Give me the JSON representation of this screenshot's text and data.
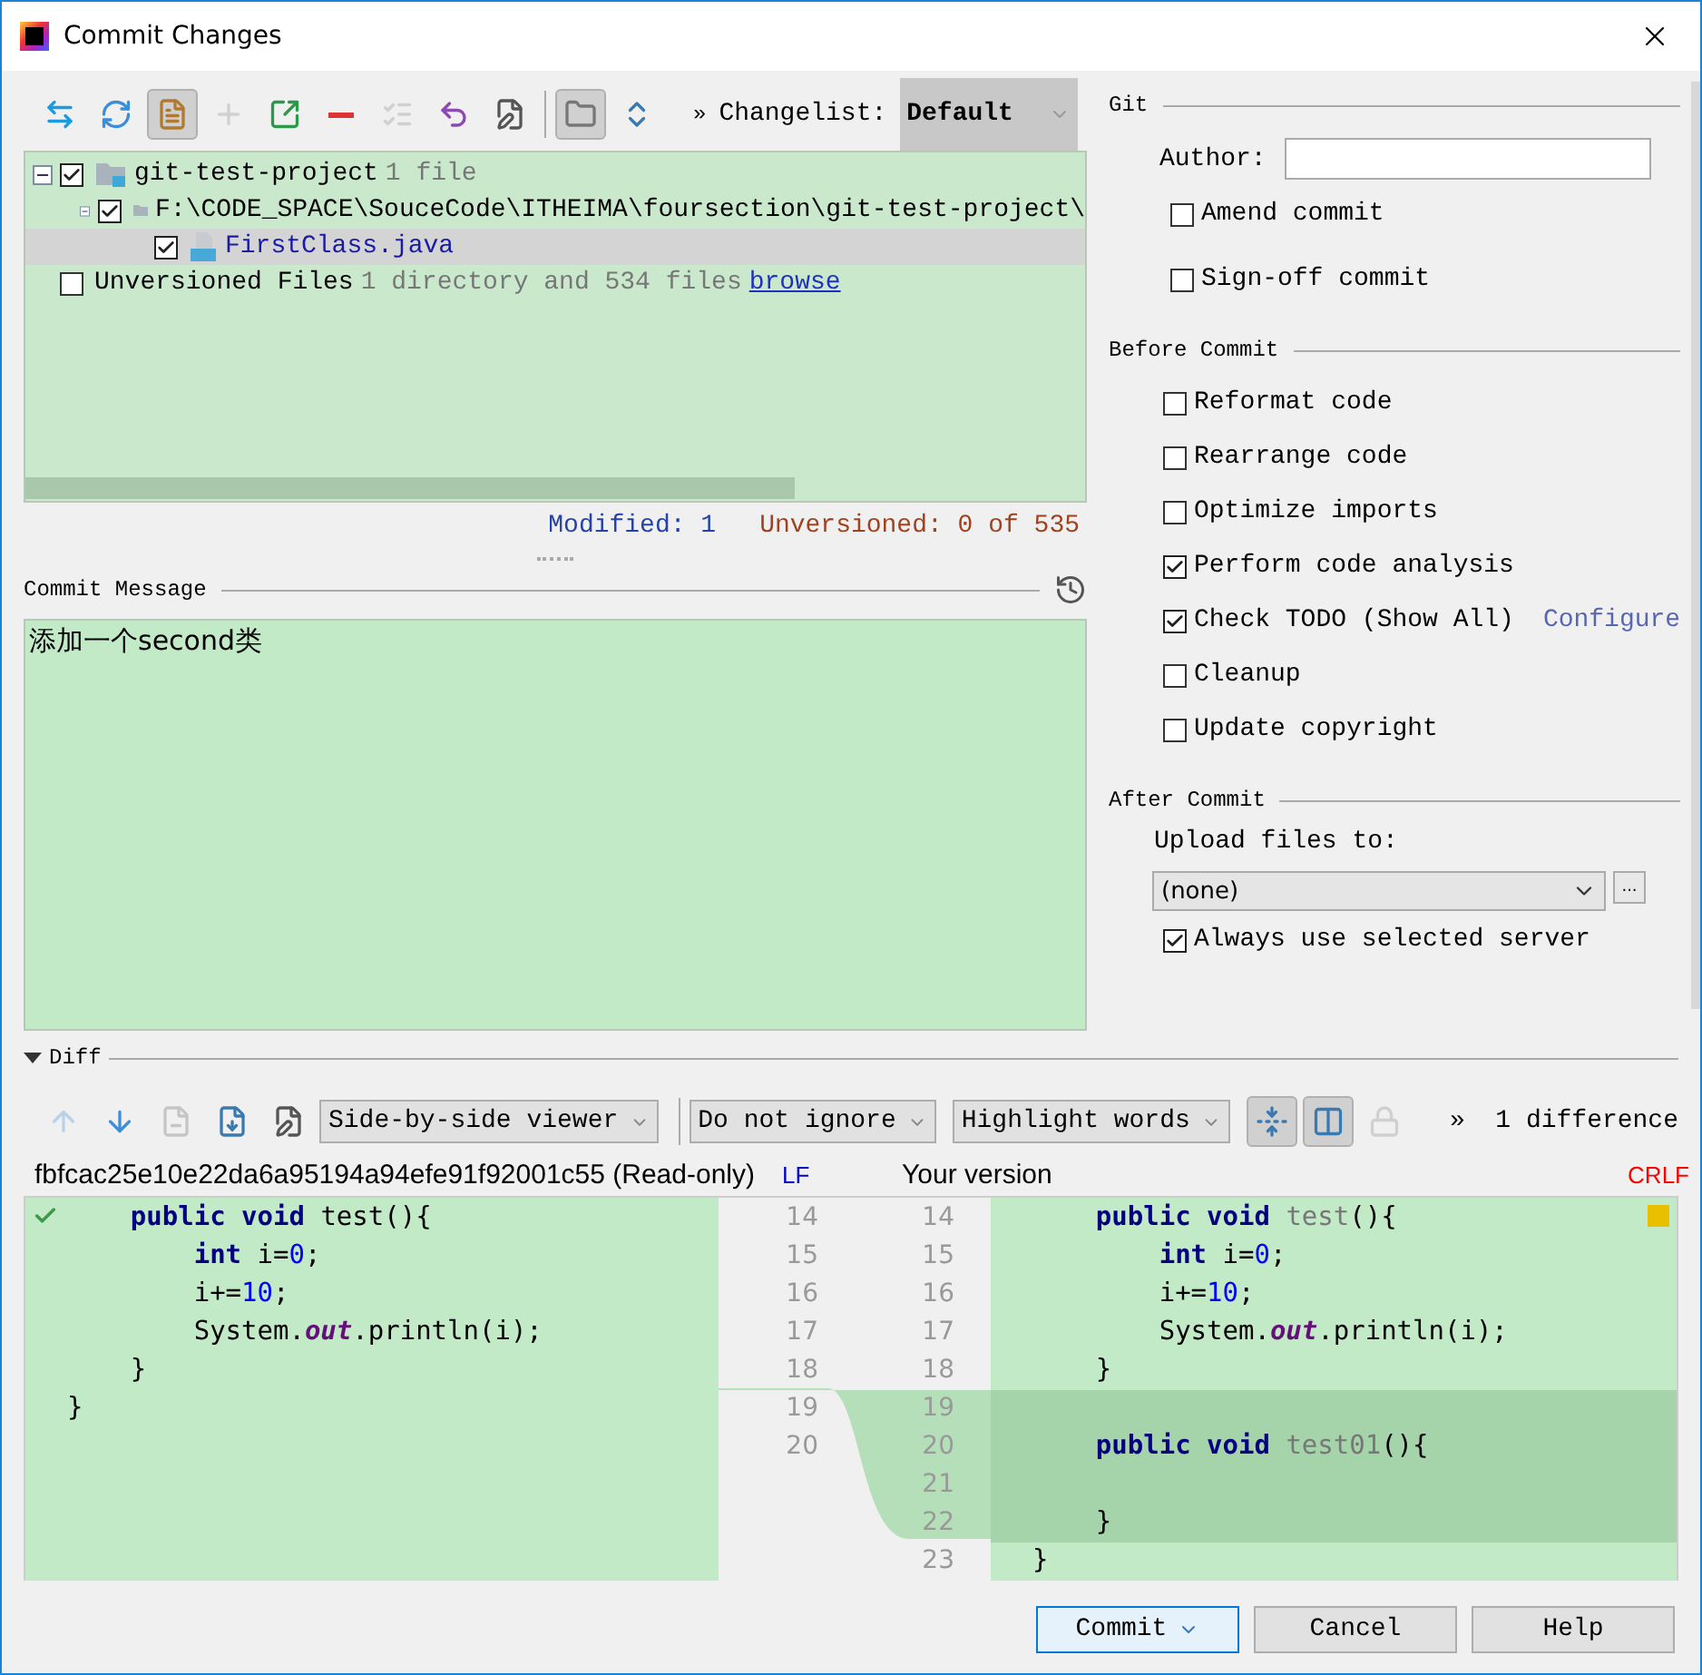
{
  "window": {
    "title": "Commit Changes"
  },
  "changes_toolbar": [
    {
      "kind": "move",
      "pressed": false,
      "disabled": false
    },
    {
      "kind": "refresh",
      "pressed": false,
      "disabled": false
    },
    {
      "kind": "document",
      "pressed": true,
      "disabled": false
    },
    {
      "kind": "add",
      "pressed": false,
      "disabled": true
    },
    {
      "kind": "move-to",
      "pressed": false,
      "disabled": false
    },
    {
      "kind": "remove",
      "pressed": false,
      "disabled": false
    },
    {
      "kind": "group",
      "pressed": false,
      "disabled": true
    },
    {
      "kind": "rollback",
      "pressed": false,
      "disabled": false
    },
    {
      "kind": "edit",
      "pressed": false,
      "disabled": false
    },
    {
      "kind": "separator"
    },
    {
      "kind": "folders",
      "pressed": true,
      "disabled": false
    },
    {
      "kind": "expand",
      "pressed": false,
      "disabled": false
    }
  ],
  "changelist": {
    "overflow": "»",
    "label": "Changelist:",
    "value": "Default"
  },
  "tree": [
    {
      "kind": "module",
      "label": "git-test-project",
      "meta": "1 file",
      "checked": true,
      "expanded": true,
      "selected": false,
      "children": [
        {
          "kind": "folder",
          "label": "F:\\CODE_SPACE\\SouceCode\\ITHEIMA\\foursection\\git-test-project\\",
          "checked": true,
          "expanded": true,
          "selected": false,
          "children": [
            {
              "kind": "file",
              "label": "FirstClass.java",
              "checked": true,
              "selected": true
            }
          ]
        }
      ]
    },
    {
      "kind": "group",
      "label": "Unversioned Files",
      "meta": "1 directory and 534 files",
      "link": "browse",
      "checked": false,
      "selected": false
    }
  ],
  "status": {
    "modified": "Modified: 1",
    "unversioned": "Unversioned: 0 of 535"
  },
  "commit_message": {
    "label": "Commit Message",
    "value": "添加一个second类"
  },
  "git": {
    "title": "Git",
    "author_label": "Author:",
    "options": [
      {
        "label": "Amend commit",
        "checked": false
      },
      {
        "label": "Sign-off commit",
        "checked": false
      }
    ]
  },
  "before_commit": {
    "title": "Before Commit",
    "options": [
      {
        "label": "Reformat code",
        "checked": false
      },
      {
        "label": "Rearrange code",
        "checked": false
      },
      {
        "label": "Optimize imports",
        "checked": false
      },
      {
        "label": "Perform code analysis",
        "checked": true
      },
      {
        "label": "Check TODO (Show All)",
        "checked": true,
        "link": "Configure"
      },
      {
        "label": "Cleanup",
        "checked": false
      },
      {
        "label": "Update copyright",
        "checked": false
      }
    ]
  },
  "after_commit": {
    "title": "After Commit",
    "upload_label": "Upload files to:",
    "upload_value": "(none)",
    "more": "...",
    "options": [
      {
        "label": "Always use selected server",
        "checked": true
      }
    ]
  },
  "diff": {
    "title": "Diff",
    "expanded": true,
    "toolbar": [
      {
        "kind": "previous",
        "disabled": true
      },
      {
        "kind": "next",
        "disabled": false
      },
      {
        "kind": "close-file",
        "disabled": true
      },
      {
        "kind": "open-file",
        "disabled": false
      },
      {
        "kind": "edit",
        "disabled": false
      }
    ],
    "dropdowns": [
      "Side-by-side viewer",
      "Do not ignore",
      "Highlight words"
    ],
    "toggles": [
      {
        "kind": "collapse",
        "pressed": true,
        "disabled": false
      },
      {
        "kind": "columns",
        "pressed": true,
        "disabled": false
      },
      {
        "kind": "lock",
        "pressed": false,
        "disabled": true
      }
    ],
    "overflow": "»",
    "differences": "1 difference",
    "left": {
      "title": "fbfcac25e10e22da6a95194a94efe91f92001c55 (Read-only)",
      "line_separator": "LF",
      "lines": [
        {
          "number": "14",
          "changed": false,
          "segments": [
            {
              "text": "    public",
              "kind": "keyword"
            },
            {
              "text": " void",
              "kind": "keyword"
            },
            {
              "text": " test(){"
            }
          ]
        },
        {
          "number": "15",
          "changed": false,
          "segments": [
            {
              "text": "        int",
              "kind": "keyword"
            },
            {
              "text": " i="
            },
            {
              "text": "0",
              "kind": "number"
            },
            {
              "text": ";"
            }
          ]
        },
        {
          "number": "16",
          "changed": false,
          "segments": [
            {
              "text": "        i+="
            },
            {
              "text": "10",
              "kind": "number"
            },
            {
              "text": ";"
            }
          ]
        },
        {
          "number": "17",
          "changed": false,
          "segments": [
            {
              "text": "        System."
            },
            {
              "text": "out",
              "kind": "field"
            },
            {
              "text": ".println(i);"
            }
          ]
        },
        {
          "number": "18",
          "changed": false,
          "segments": [
            {
              "text": "    }"
            }
          ]
        },
        {
          "number": "19",
          "changed": false,
          "segments": [
            {
              "text": "}"
            }
          ]
        },
        {
          "number": "20",
          "changed": false
        }
      ]
    },
    "right": {
      "title": "Your version",
      "line_separator": "CRLF",
      "lines": [
        {
          "number": "14",
          "changed": false,
          "segments": [
            {
              "text": "    public",
              "kind": "keyword"
            },
            {
              "text": " void",
              "kind": "keyword"
            },
            {
              "text": " test",
              "kind": "unused"
            },
            {
              "text": "(){"
            }
          ]
        },
        {
          "number": "15",
          "changed": false,
          "segments": [
            {
              "text": "        int",
              "kind": "keyword"
            },
            {
              "text": " i="
            },
            {
              "text": "0",
              "kind": "number"
            },
            {
              "text": ";"
            }
          ]
        },
        {
          "number": "16",
          "changed": false,
          "segments": [
            {
              "text": "        i+="
            },
            {
              "text": "10",
              "kind": "number"
            },
            {
              "text": ";"
            }
          ]
        },
        {
          "number": "17",
          "changed": false,
          "segments": [
            {
              "text": "        System."
            },
            {
              "text": "out",
              "kind": "field"
            },
            {
              "text": ".println(i);"
            }
          ]
        },
        {
          "number": "18",
          "changed": false,
          "segments": [
            {
              "text": "    }"
            }
          ]
        },
        {
          "number": "19",
          "changed": true
        },
        {
          "number": "20",
          "changed": true,
          "segments": [
            {
              "text": "    public",
              "kind": "keyword"
            },
            {
              "text": " void",
              "kind": "keyword"
            },
            {
              "text": " test01",
              "kind": "unused"
            },
            {
              "text": "(){"
            }
          ]
        },
        {
          "number": "21",
          "changed": true
        },
        {
          "number": "22",
          "changed": true,
          "segments": [
            {
              "text": "    }"
            }
          ]
        },
        {
          "number": "23",
          "changed": false,
          "segments": [
            {
              "text": "}"
            }
          ]
        }
      ]
    }
  },
  "buttons": [
    {
      "label": "Commit",
      "default": true,
      "dropdown": true
    },
    {
      "label": "Cancel",
      "default": false,
      "dropdown": false
    },
    {
      "label": "Help",
      "default": false,
      "dropdown": false
    }
  ]
}
